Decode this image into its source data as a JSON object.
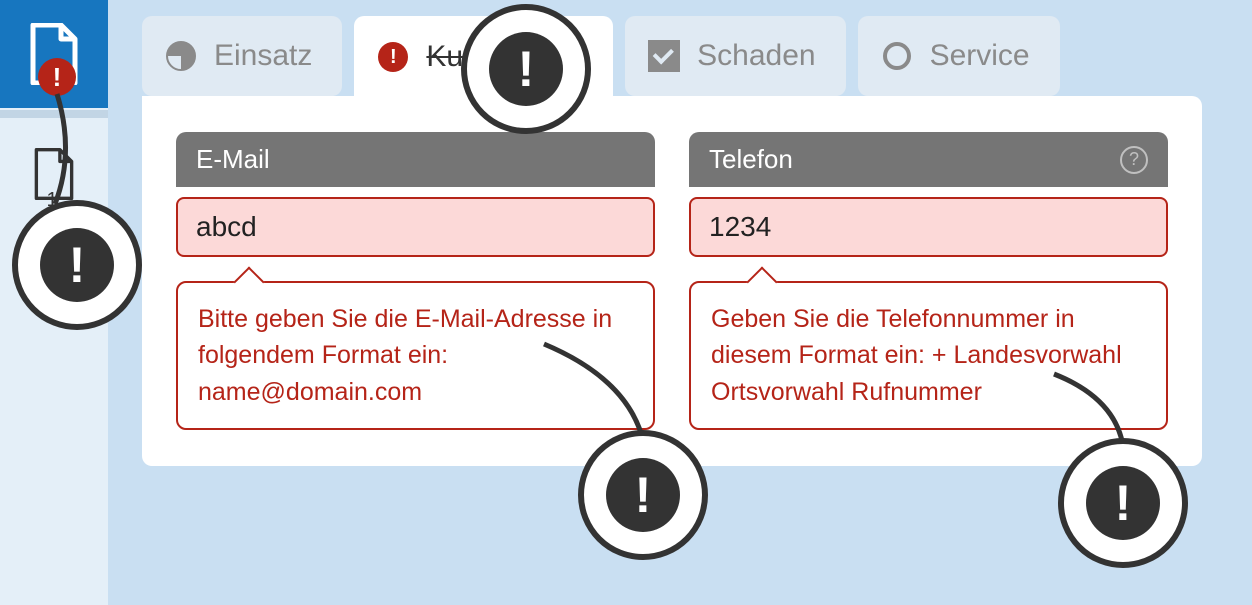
{
  "sidebar": {
    "items": [
      {
        "label": ""
      },
      {
        "label": "1"
      }
    ]
  },
  "tabs": {
    "items": [
      {
        "label": "Einsatz"
      },
      {
        "label": "Kunde"
      },
      {
        "label": "Schaden"
      },
      {
        "label": "Service"
      }
    ]
  },
  "fields": {
    "email": {
      "header": "E-Mail",
      "value": "abcd",
      "error": "Bitte geben Sie die E-Mail-Adresse in folgendem Format ein: name@domain.com"
    },
    "phone": {
      "header": "Telefon",
      "value": "1234",
      "error": "Geben Sie die Telefonnummer in diesem Format ein: + Landes­vorwahl Ortsvorwahl Rufnummer"
    }
  }
}
